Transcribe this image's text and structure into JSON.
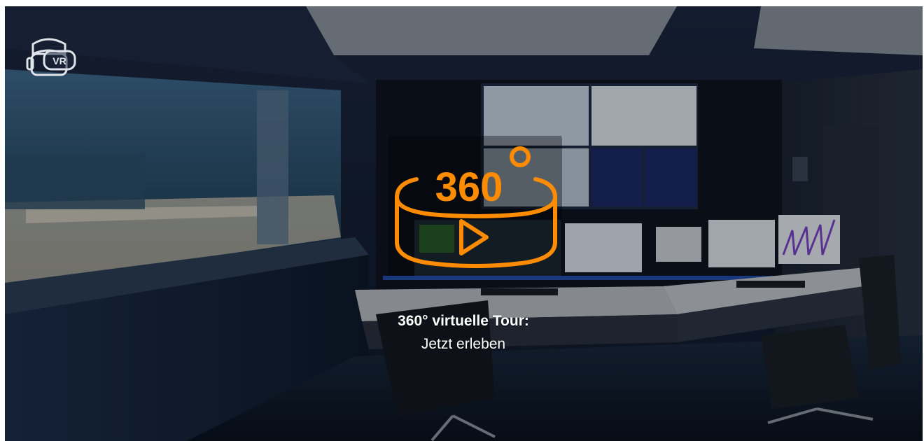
{
  "tour": {
    "logo_text": "360°",
    "title": "360° virtuelle Tour:",
    "subtitle": "Jetzt erleben",
    "accent_color": "#ff8c00"
  },
  "vr_badge": {
    "label": "VR",
    "icon": "vr-headset-icon"
  },
  "preview": {
    "description_icon": "panorama-image",
    "scene_colors": [
      "#0b1320",
      "#14243a",
      "#1e3a5a"
    ]
  }
}
